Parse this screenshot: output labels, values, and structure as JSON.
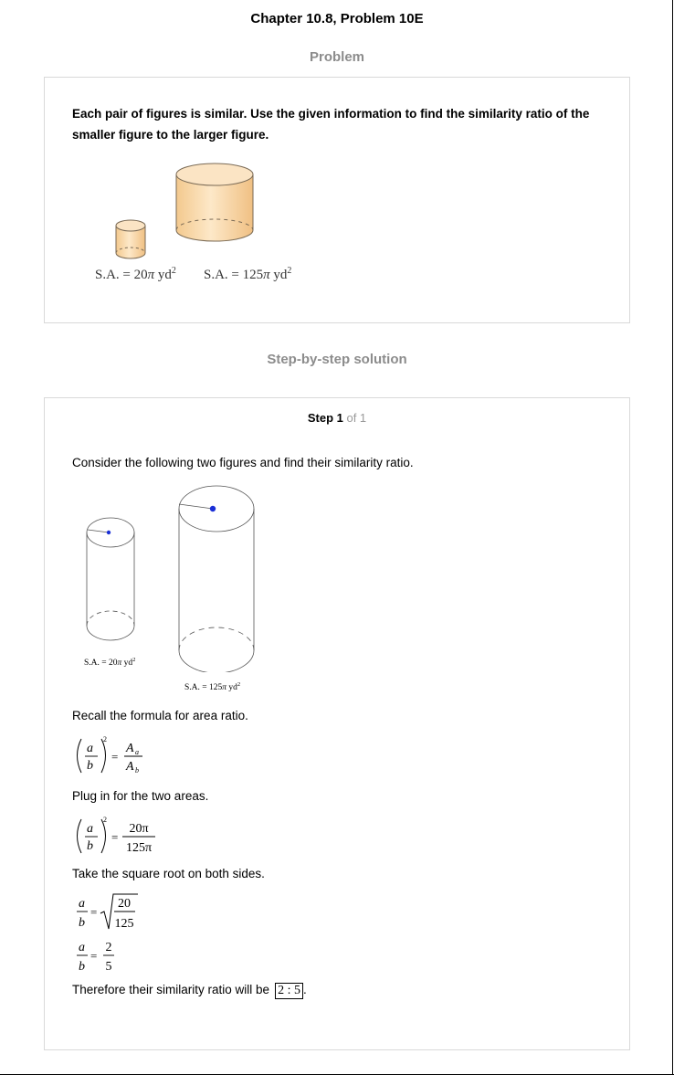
{
  "header": {
    "title": "Chapter 10.8, Problem 10E"
  },
  "problem": {
    "heading": "Problem",
    "text": "Each pair of figures is similar. Use the given information to find the similarity ratio of the smaller figure to the larger figure.",
    "figure": {
      "small_label": {
        "prefix": "S.A. = 20",
        "pi": "π",
        "unit": " yd",
        "exp": "2"
      },
      "large_label": {
        "prefix": "S.A. = 125",
        "pi": "π",
        "unit": " yd",
        "exp": "2"
      }
    }
  },
  "solution": {
    "heading": "Step-by-step solution",
    "step": {
      "label": "Step 1",
      "of": " of 1"
    },
    "intro": "Consider the following two figures and find their similarity ratio.",
    "figure": {
      "small_label": {
        "prefix": "S.A. = 20",
        "pi": "π",
        "unit": " yd",
        "exp": "2"
      },
      "large_label": {
        "prefix": "S.A. = 125",
        "pi": "π",
        "unit": " yd",
        "exp": "2"
      }
    },
    "recall_text": "Recall the formula for area ratio.",
    "plug_text": "Plug in for the two areas.",
    "sqrt_text": "Take the square root on both sides.",
    "formula": {
      "a": "a",
      "b": "b",
      "exp": "2",
      "eq": "=",
      "A": "A",
      "sub_a": "a",
      "sub_b": "b"
    },
    "plug": {
      "num": "20π",
      "den": "125π"
    },
    "sqrt": {
      "num": "20",
      "den": "125"
    },
    "result": {
      "num": "2",
      "den": "5"
    },
    "conclusion_text": "Therefore their similarity ratio will be",
    "answer": "2 : 5",
    "period": "."
  }
}
